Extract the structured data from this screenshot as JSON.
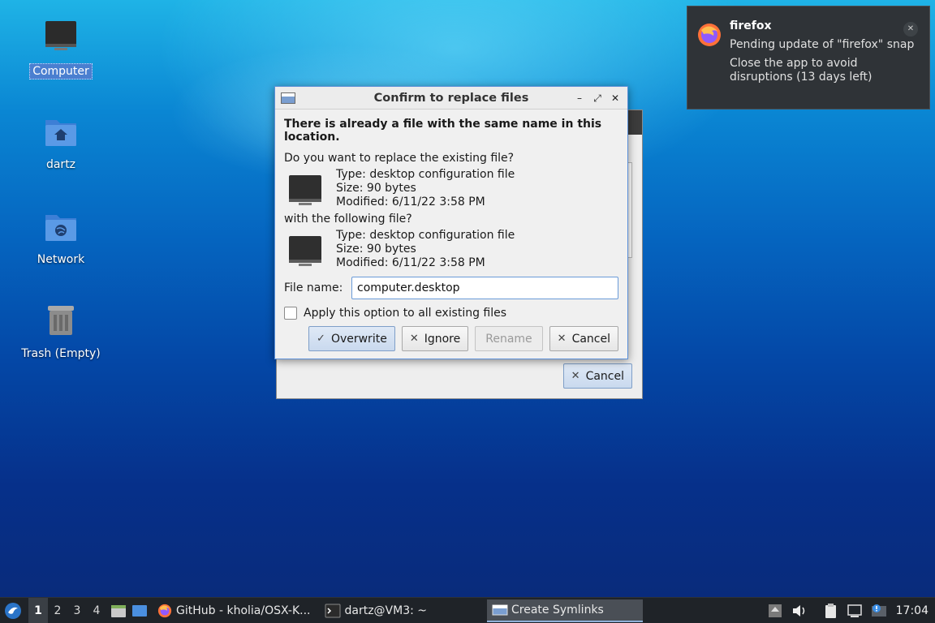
{
  "desktop": {
    "icons": [
      {
        "label": "Computer",
        "icon": "monitor-icon"
      },
      {
        "label": "dartz",
        "icon": "home-folder-icon"
      },
      {
        "label": "Network",
        "icon": "network-folder-icon"
      },
      {
        "label": "Trash (Empty)",
        "icon": "trash-icon"
      }
    ]
  },
  "background_dialog": {
    "cancel_label": "Cancel"
  },
  "dialog": {
    "title": "Confirm to replace files",
    "headline": "There is already a file with the same name in this location.",
    "question": "Do you want to replace the existing file?",
    "existing_file": {
      "type": "Type: desktop configuration file",
      "size": "Size: 90 bytes",
      "modified": "Modified: 6/11/22 3:58 PM"
    },
    "with_label": "with the following file?",
    "new_file": {
      "type": "Type: desktop configuration file",
      "size": "Size: 90 bytes",
      "modified": "Modified: 6/11/22 3:58 PM"
    },
    "filename_label": "File name:",
    "filename_value": "computer.desktop",
    "apply_all_label": "Apply this option to all existing files",
    "buttons": {
      "overwrite": "Overwrite",
      "ignore": "Ignore",
      "rename": "Rename",
      "cancel": "Cancel"
    }
  },
  "notification": {
    "app": "firefox",
    "line1": "Pending update of \"firefox\" snap",
    "line2": "Close the app to avoid disruptions (13 days left)"
  },
  "taskbar": {
    "workspaces": [
      "1",
      "2",
      "3",
      "4"
    ],
    "tasks": [
      {
        "label": "GitHub - kholia/OSX-K...",
        "icon": "firefox-icon"
      },
      {
        "label": "dartz@VM3: ~",
        "icon": "terminal-icon"
      },
      {
        "label": "Create Symlinks",
        "icon": "window-icon"
      }
    ],
    "clock": "17:04"
  },
  "colors": {
    "accent": "#5a8fd8",
    "taskbar": "#1f2328",
    "notification_bg": "#2f3337"
  }
}
